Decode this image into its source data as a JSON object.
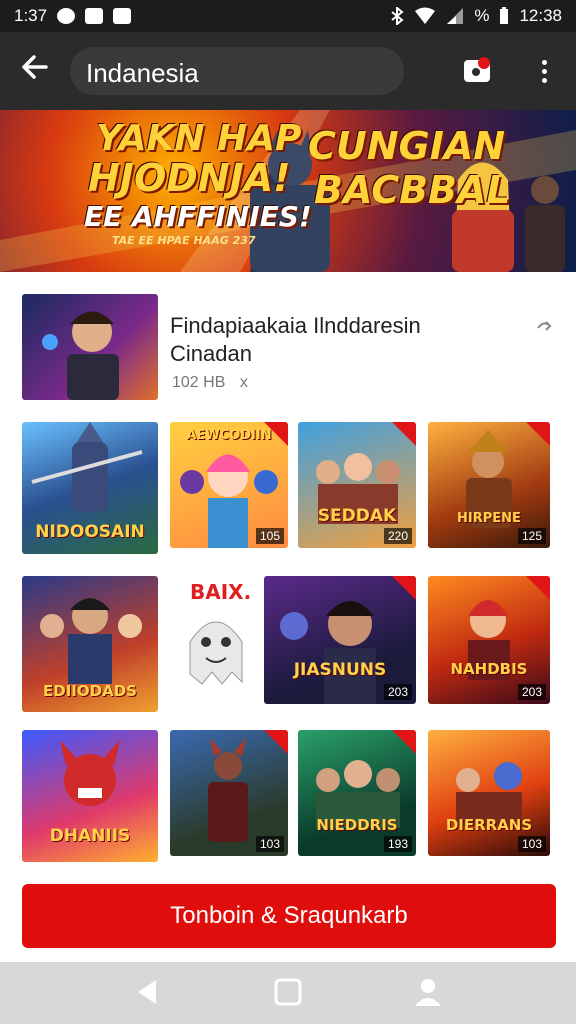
{
  "status_bar": {
    "time_left": "1:37",
    "battery_text": "%",
    "time_right": "12:38"
  },
  "toolbar": {
    "search_value": "Indanesia"
  },
  "banner": {
    "left_line1": "YAKN HAP",
    "left_line2": "HJODNJA!",
    "left_line3": "EE AHFFINIES!",
    "left_small": "TAE EE HPAE HAAG 237",
    "right_line1": "CUNGIAN",
    "right_line2": "BACBBAL"
  },
  "app": {
    "title_line1": "Findapiaakaia Ilnddaresin",
    "title_line2": "Cinadan",
    "meta": "102 HB",
    "meta_icon": "x"
  },
  "tiles": [
    {
      "label": "NIDOOSAIN",
      "count": ""
    },
    {
      "label": "AEWCODIIN",
      "count": "105"
    },
    {
      "label": "SEDDAK",
      "count": "220"
    },
    {
      "label": "HIRPENE",
      "count": "125"
    },
    {
      "label": "EDIIODADS",
      "count": ""
    },
    {
      "label": "BAIX.",
      "count": ""
    },
    {
      "label": "JIASNUNS",
      "count": "203"
    },
    {
      "label": "NAHDBIS",
      "count": "203"
    },
    {
      "label": "DHANIIS",
      "count": ""
    },
    {
      "label": "",
      "count": "103"
    },
    {
      "label": "NIEDDRIS",
      "count": "193"
    },
    {
      "label": "DIERRANS",
      "count": "103"
    }
  ],
  "cta": {
    "label": "Tonboin & Sraqunkarb"
  },
  "colors": {
    "accent": "#e00d0d",
    "toolbar": "#2b2b2b"
  }
}
